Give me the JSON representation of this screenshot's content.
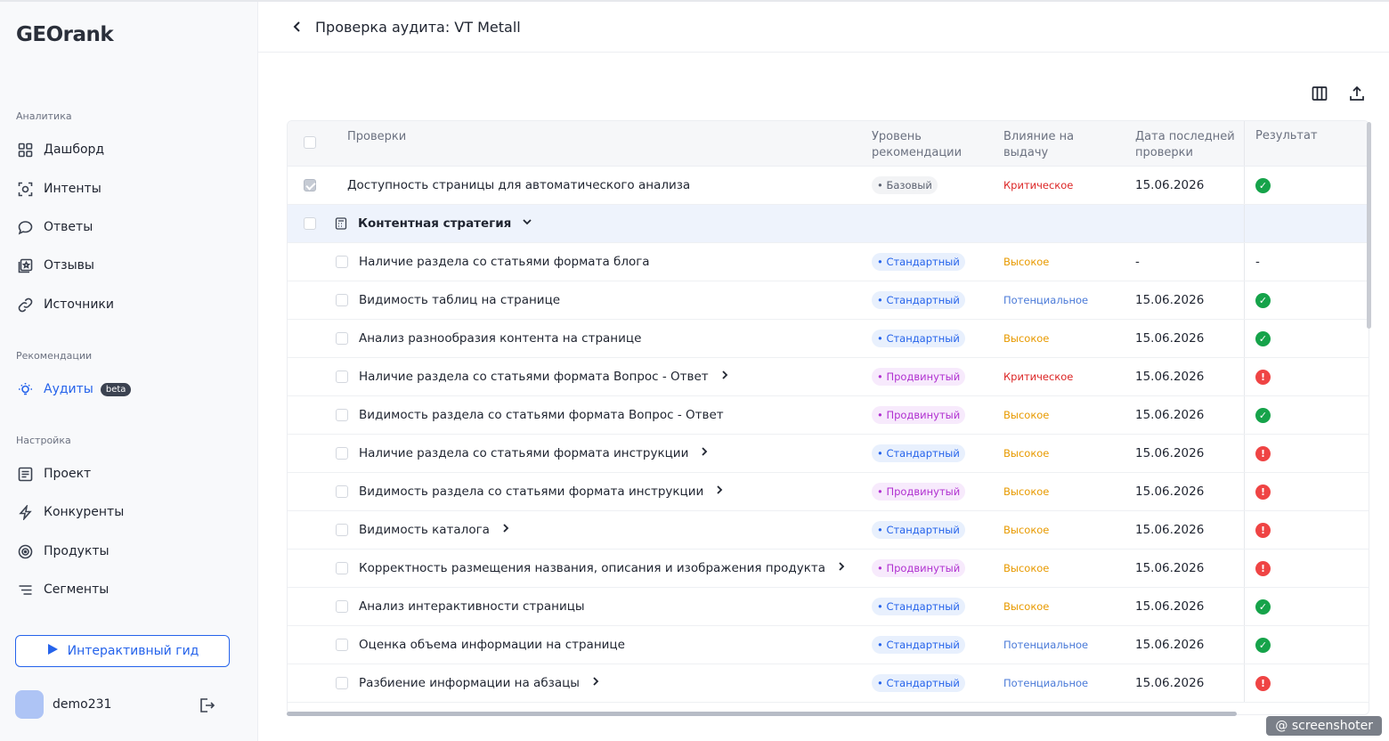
{
  "sidebar": {
    "logo": "GEOrank",
    "sections": {
      "analytics": "Аналитика",
      "recommendations": "Рекомендации",
      "settings": "Настройка"
    },
    "items": {
      "dashboard": "Дашборд",
      "intents": "Интенты",
      "answers": "Ответы",
      "reviews": "Отзывы",
      "sources": "Источники",
      "audits": "Аудиты",
      "audits_badge": "beta",
      "project": "Проект",
      "competitors": "Конкуренты",
      "products": "Продукты",
      "segments": "Сегменты"
    },
    "guide_button": "Интерактивный гид",
    "user": "demo231"
  },
  "header": {
    "title": "Проверка аудита: VT Metall"
  },
  "table": {
    "headers": {
      "checks": "Проверки",
      "level": "Уровень рекомендации",
      "impact": "Влияние на выдачу",
      "date": "Дата последней проверки",
      "result": "Результат"
    },
    "top_row": {
      "name": "Доступность страницы для автоматического анализа",
      "level": "• Базовый",
      "impact": "Критическое",
      "date": "15.06.2026"
    },
    "group": {
      "name": "Контентная стратегия"
    },
    "rows": [
      {
        "name": "Наличие раздела со статьями формата блога",
        "level": "• Стандартный",
        "impact": "Высокое",
        "date": "-",
        "result": "-"
      },
      {
        "name": "Видимость таблиц на странице",
        "level": "• Стандартный",
        "impact": "Потенциальное",
        "date": "15.06.2026",
        "result": "ok"
      },
      {
        "name": "Анализ разнообразия контента на странице",
        "level": "• Стандартный",
        "impact": "Высокое",
        "date": "15.06.2026",
        "result": "ok"
      },
      {
        "name": "Наличие раздела со статьями формата Вопрос - Ответ",
        "level": "• Продвинутый",
        "impact": "Критическое",
        "date": "15.06.2026",
        "result": "bad"
      },
      {
        "name": "Видимость раздела со статьями формата Вопрос - Ответ",
        "level": "• Продвинутый",
        "impact": "Высокое",
        "date": "15.06.2026",
        "result": "ok"
      },
      {
        "name": "Наличие раздела со статьями формата инструкции",
        "level": "• Стандартный",
        "impact": "Высокое",
        "date": "15.06.2026",
        "result": "bad"
      },
      {
        "name": "Видимость раздела со статьями формата инструкции",
        "level": "• Продвинутый",
        "impact": "Высокое",
        "date": "15.06.2026",
        "result": "bad"
      },
      {
        "name": "Видимость каталога",
        "level": "• Стандартный",
        "impact": "Высокое",
        "date": "15.06.2026",
        "result": "bad"
      },
      {
        "name": "Корректность размещения названия, описания и изображения продукта",
        "level": "• Продвинутый",
        "impact": "Высокое",
        "date": "15.06.2026",
        "result": "bad"
      },
      {
        "name": "Анализ интерактивности страницы",
        "level": "• Стандартный",
        "impact": "Высокое",
        "date": "15.06.2026",
        "result": "ok"
      },
      {
        "name": "Оценка объема информации на странице",
        "level": "• Стандартный",
        "impact": "Потенциальное",
        "date": "15.06.2026",
        "result": "ok"
      },
      {
        "name": "Разбиение информации на абзацы",
        "level": "• Стандартный",
        "impact": "Потенциальное",
        "date": "15.06.2026",
        "result": "bad"
      }
    ]
  },
  "watermark": "@ screenshoter"
}
